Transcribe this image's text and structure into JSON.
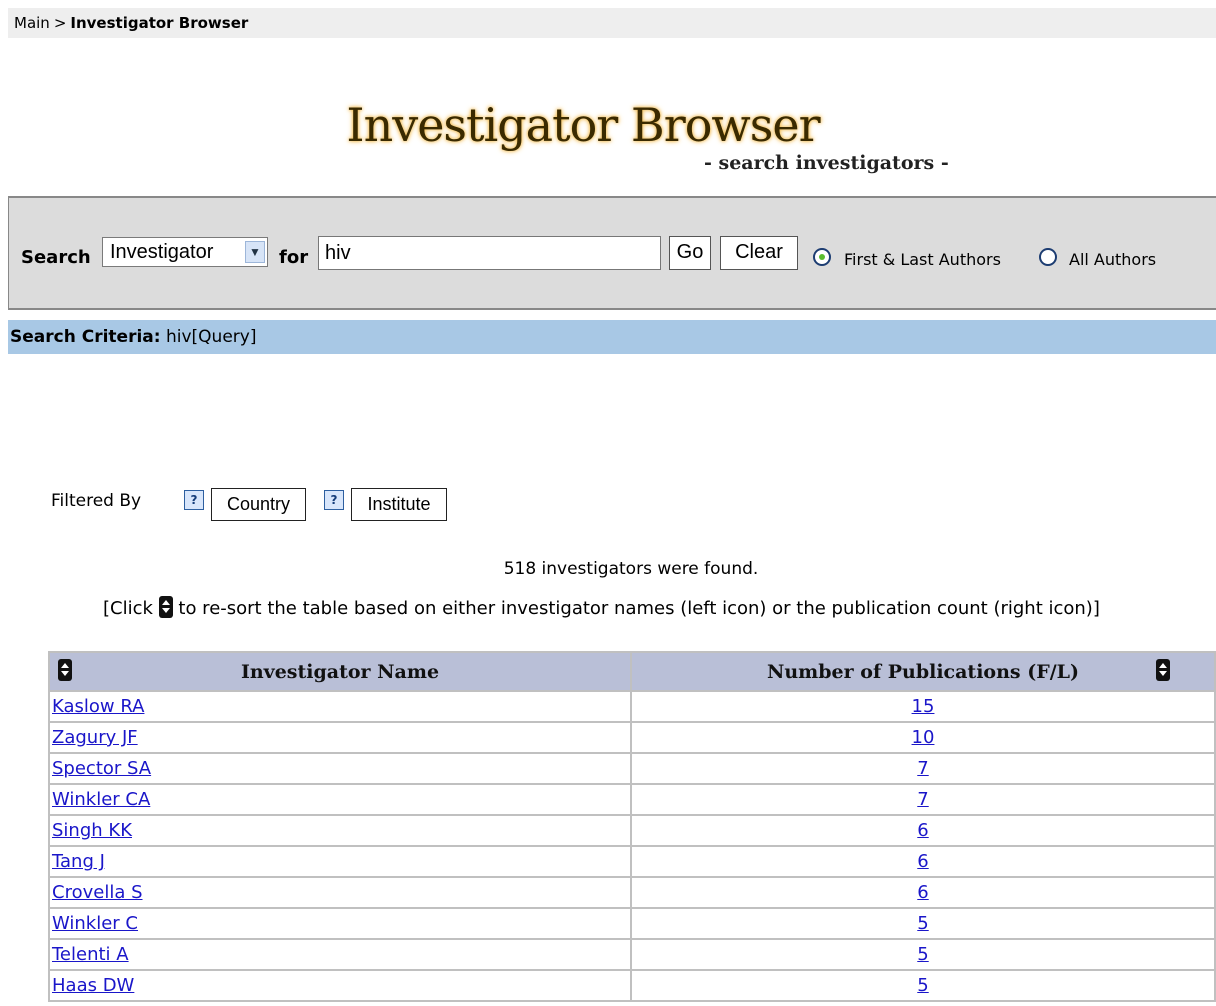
{
  "breadcrumb": {
    "root": "Main",
    "separator": ">",
    "current": "Investigator Browser"
  },
  "header": {
    "title": "Investigator Browser",
    "subtitle": "- search investigators -"
  },
  "search": {
    "label": "Search",
    "field_selected": "Investigator",
    "for_label": "for",
    "query": "hiv",
    "go_label": "Go",
    "clear_label": "Clear",
    "author_options": [
      {
        "label": "First & Last Authors",
        "checked": true
      },
      {
        "label": "All Authors",
        "checked": false
      }
    ]
  },
  "criteria": {
    "label": "Search Criteria:",
    "value": "hiv[Query]"
  },
  "filters": {
    "label": "Filtered By",
    "help_icon": "?",
    "country_label": "Country",
    "institute_label": "Institute"
  },
  "results": {
    "count_text": "518 investigators were found.",
    "sort_note_prefix": "[Click",
    "sort_note_suffix": "to re-sort the table based on either investigator names (left icon) or the publication count (right icon)]",
    "columns": [
      "Investigator Name",
      "Number of Publications (F/L)"
    ],
    "rows": [
      {
        "name": "Kaslow RA",
        "count": "15"
      },
      {
        "name": "Zagury JF",
        "count": "10"
      },
      {
        "name": "Spector SA",
        "count": "7"
      },
      {
        "name": "Winkler CA",
        "count": "7"
      },
      {
        "name": "Singh KK",
        "count": "6"
      },
      {
        "name": "Tang J",
        "count": "6"
      },
      {
        "name": "Crovella S",
        "count": "6"
      },
      {
        "name": "Winkler C",
        "count": "5"
      },
      {
        "name": "Telenti A",
        "count": "5"
      },
      {
        "name": "Haas DW",
        "count": "5"
      }
    ]
  },
  "colors": {
    "criteria_bar": "#a8c8e5",
    "search_panel": "#dcdcdc",
    "link": "#1a16c9",
    "table_header": "#b9bfd7"
  }
}
